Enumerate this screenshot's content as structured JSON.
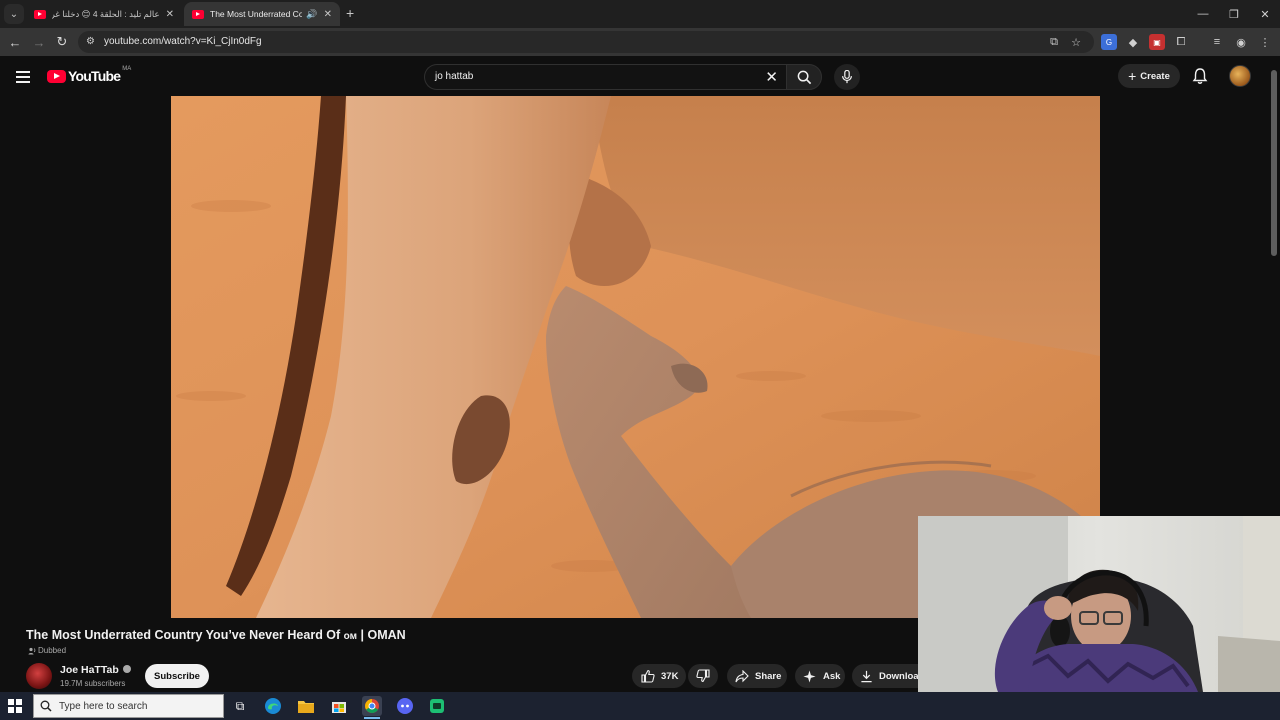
{
  "browser": {
    "tabs": [
      {
        "title": "عالم تليد : الحلقة 4 😊 دخلنا غرفة",
        "active": false
      },
      {
        "title": "The Most Underrated Coun",
        "active": true
      }
    ],
    "url": "youtube.com/watch?v=Ki_CjIn0dFg"
  },
  "youtube": {
    "logo_text": "YouTube",
    "country_code": "MA",
    "search_query": "jo hattab",
    "create_label": "Create"
  },
  "video": {
    "title": "The Most Underrated Country You’ve Never Heard Of",
    "title_flag": "ом",
    "title_suffix": "| OMAN",
    "dubbed_label": "Dubbed",
    "channel_name": "Joe HaTTab",
    "subscribers": "19.7M subscribers",
    "subscribe_label": "Subscribe",
    "likes": "37K",
    "share_label": "Share",
    "ask_label": "Ask",
    "download_label": "Download"
  },
  "taskbar": {
    "search_placeholder": "Type here to search"
  },
  "colors": {
    "youtube_red": "#ff0033",
    "background": "#0f0f0f",
    "taskbar": "#1c2230"
  }
}
